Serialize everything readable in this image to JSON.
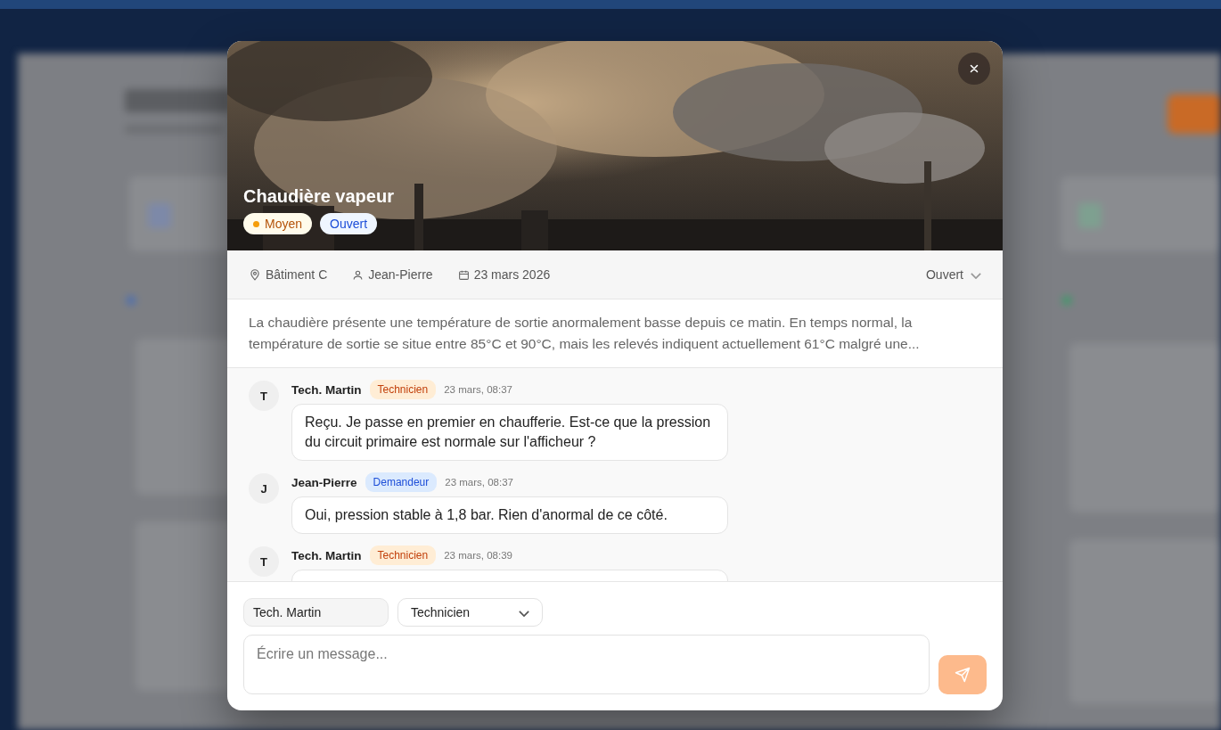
{
  "modal": {
    "title": "Chaudière vapeur",
    "badges": [
      {
        "label": "Moyen",
        "kind": "priority",
        "color": "#f59e0b"
      },
      {
        "label": "Ouvert",
        "kind": "status"
      }
    ],
    "meta": {
      "location": "Bâtiment C",
      "requester": "Jean-Pierre",
      "date": "23 mars 2026",
      "status_select": "Ouvert"
    },
    "description": "La chaudière présente une température de sortie anormalement basse depuis ce matin. En temps normal, la température de sortie se situe entre 85°C et 90°C, mais les relevés indiquent actuellement 61°C malgré une...",
    "messages": [
      {
        "initial": "T",
        "author": "Tech. Martin",
        "role": "Technicien",
        "kind": "technician",
        "time": "23 mars, 08:37",
        "text": "Reçu. Je passe en premier en chaufferie. Est-ce que la pression du circuit primaire est normale sur l'afficheur ?"
      },
      {
        "initial": "J",
        "author": "Jean-Pierre",
        "role": "Demandeur",
        "kind": "requester",
        "time": "23 mars, 08:37",
        "text": "Oui, pression stable à 1,8 bar. Rien d'anormal de ce côté."
      },
      {
        "initial": "T",
        "author": "Tech. Martin",
        "role": "Technicien",
        "kind": "technician",
        "time": "23 mars, 08:39"
      }
    ],
    "composer": {
      "name": "Tech. Martin",
      "role": "Technicien",
      "placeholder": "Écrire un message..."
    }
  }
}
